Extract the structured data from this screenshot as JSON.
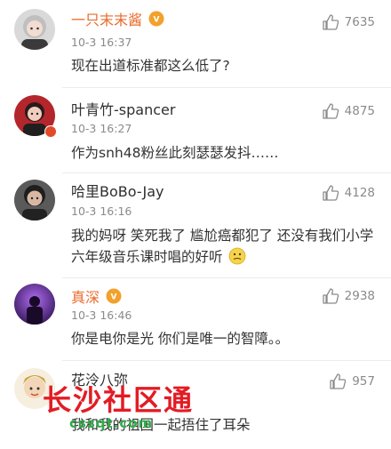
{
  "comments": [
    {
      "avatar": "avatar-woman-grey-hair",
      "user": "一只末末酱",
      "verified": true,
      "time": "10-3 16:37",
      "likes": "7635",
      "text": "现在出道标准都这么低了?"
    },
    {
      "avatar": "avatar-man-red-background",
      "user": "叶青竹-spancer",
      "verified": false,
      "time": "10-3 16:27",
      "likes": "4875",
      "text": "作为snh48粉丝此刻瑟瑟发抖……"
    },
    {
      "avatar": "avatar-man-dark",
      "user": "哈里BoBo-Jay",
      "verified": false,
      "time": "10-3 16:16",
      "likes": "4128",
      "text": "我的妈呀 笑死我了 尴尬癌都犯了 还没有我们小学六年级音乐课时唱的好听"
    },
    {
      "avatar": "avatar-purple-stage",
      "user": "真深",
      "verified": true,
      "time": "10-3 16:46",
      "likes": "2938",
      "text": "你是电你是光 你们是唯一的智障。。"
    },
    {
      "avatar": "avatar-cartoon",
      "user": "花泠八弥",
      "verified": false,
      "time": "",
      "likes": "957",
      "text": "我和我的祖国一起捂住了耳朵"
    }
  ],
  "watermark": {
    "title": "长沙社区通",
    "url": "cssqt.com"
  },
  "colors": {
    "orange_name": "#e86b2b",
    "vip_badge": "#f2a12a",
    "watermark_red": "#e31b23",
    "watermark_green": "#2fae4a"
  }
}
